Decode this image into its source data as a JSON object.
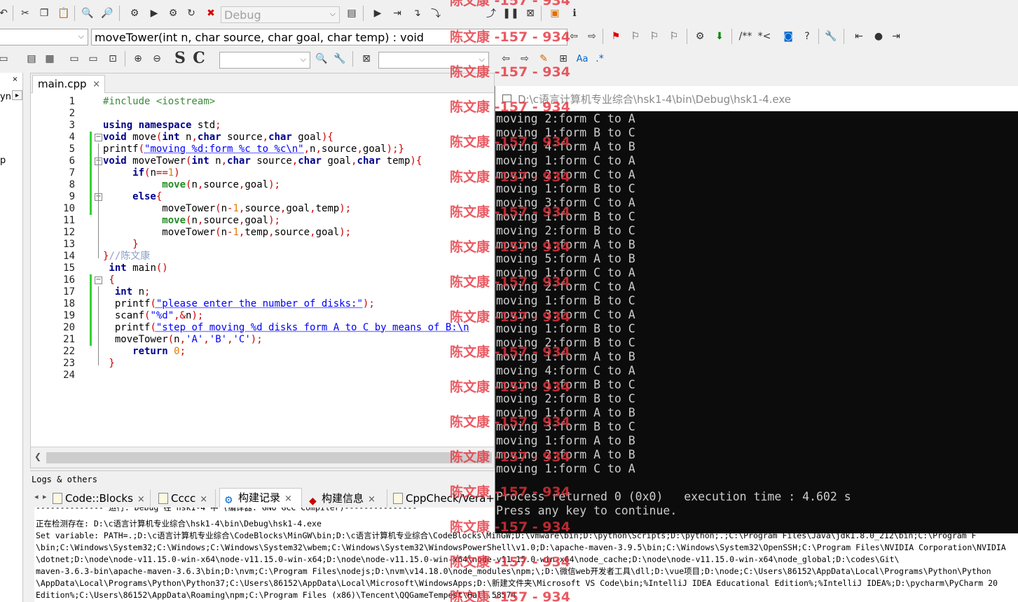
{
  "toolbar": {
    "build_target": "Debug",
    "function_signature": "moveTower(int n, char source, char goal, char temp) : void",
    "search_text": "",
    "find_text": "",
    "label_s": "S",
    "label_c": "C",
    "doc_comment": "/**",
    "comment_star": "*<",
    "regex_label": ".*"
  },
  "left_panel": {
    "close_label": "×",
    "arrow_label": "▸",
    "cut_text_1": "yn",
    "cut_text_2": "p"
  },
  "editor": {
    "tab_label": "main.cpp",
    "tab_close": "×",
    "line_numbers": [
      "1",
      "2",
      "3",
      "4",
      "5",
      "6",
      "7",
      "8",
      "9",
      "10",
      "11",
      "12",
      "13",
      "14",
      "15",
      "16",
      "17",
      "18",
      "19",
      "20",
      "21",
      "22",
      "23",
      "24"
    ],
    "lines": [
      [
        {
          "t": "#include <iostream>",
          "c": "#3c8a3c"
        }
      ],
      [],
      [
        {
          "t": "using namespace ",
          "c": "#00008b",
          "b": true
        },
        {
          "t": "std",
          "c": "#000"
        },
        {
          "t": ";",
          "c": "#cc0000"
        }
      ],
      [
        {
          "t": "void ",
          "c": "#00008b",
          "b": true
        },
        {
          "t": "move",
          "c": "#000"
        },
        {
          "t": "(",
          "c": "#cc0000"
        },
        {
          "t": "int ",
          "c": "#00008b",
          "b": true
        },
        {
          "t": "n",
          "c": "#000"
        },
        {
          "t": ",",
          "c": "#cc0000"
        },
        {
          "t": "char ",
          "c": "#00008b",
          "b": true
        },
        {
          "t": "source",
          "c": "#000"
        },
        {
          "t": ",",
          "c": "#cc0000"
        },
        {
          "t": "char ",
          "c": "#00008b",
          "b": true
        },
        {
          "t": "goal",
          "c": "#000"
        },
        {
          "t": "){",
          "c": "#cc0000"
        }
      ],
      [
        {
          "t": "printf",
          "c": "#000"
        },
        {
          "t": "(",
          "c": "#cc0000"
        },
        {
          "t": "\"moving %d:form %c to %c\\n\"",
          "c": "#0000ff",
          "u": true
        },
        {
          "t": ",",
          "c": "#cc0000"
        },
        {
          "t": "n",
          "c": "#000"
        },
        {
          "t": ",",
          "c": "#cc0000"
        },
        {
          "t": "source",
          "c": "#000"
        },
        {
          "t": ",",
          "c": "#cc0000"
        },
        {
          "t": "goal",
          "c": "#000"
        },
        {
          "t": ");}",
          "c": "#cc0000"
        }
      ],
      [
        {
          "t": "void ",
          "c": "#00008b",
          "b": true
        },
        {
          "t": "moveTower",
          "c": "#000"
        },
        {
          "t": "(",
          "c": "#cc0000"
        },
        {
          "t": "int ",
          "c": "#00008b",
          "b": true
        },
        {
          "t": "n",
          "c": "#000"
        },
        {
          "t": ",",
          "c": "#cc0000"
        },
        {
          "t": "char ",
          "c": "#00008b",
          "b": true
        },
        {
          "t": "source",
          "c": "#000"
        },
        {
          "t": ",",
          "c": "#cc0000"
        },
        {
          "t": "char ",
          "c": "#00008b",
          "b": true
        },
        {
          "t": "goal",
          "c": "#000"
        },
        {
          "t": ",",
          "c": "#cc0000"
        },
        {
          "t": "char ",
          "c": "#00008b",
          "b": true
        },
        {
          "t": "temp",
          "c": "#000"
        },
        {
          "t": "){",
          "c": "#cc0000"
        }
      ],
      [
        {
          "t": "     if",
          "c": "#00008b",
          "b": true
        },
        {
          "t": "(",
          "c": "#cc0000"
        },
        {
          "t": "n",
          "c": "#000"
        },
        {
          "t": "==",
          "c": "#cc0000"
        },
        {
          "t": "1",
          "c": "#e07a00"
        },
        {
          "t": ")",
          "c": "#cc0000"
        }
      ],
      [
        {
          "t": "          move",
          "c": "#228b22",
          "b": true
        },
        {
          "t": "(",
          "c": "#cc0000"
        },
        {
          "t": "n",
          "c": "#000"
        },
        {
          "t": ",",
          "c": "#cc0000"
        },
        {
          "t": "source",
          "c": "#000"
        },
        {
          "t": ",",
          "c": "#cc0000"
        },
        {
          "t": "goal",
          "c": "#000"
        },
        {
          "t": ");",
          "c": "#cc0000"
        }
      ],
      [
        {
          "t": "     else",
          "c": "#00008b",
          "b": true
        },
        {
          "t": "{",
          "c": "#cc0000"
        }
      ],
      [
        {
          "t": "          moveTower",
          "c": "#000"
        },
        {
          "t": "(",
          "c": "#cc0000"
        },
        {
          "t": "n",
          "c": "#000"
        },
        {
          "t": "-",
          "c": "#cc0000"
        },
        {
          "t": "1",
          "c": "#e07a00"
        },
        {
          "t": ",",
          "c": "#cc0000"
        },
        {
          "t": "source",
          "c": "#000"
        },
        {
          "t": ",",
          "c": "#cc0000"
        },
        {
          "t": "goal",
          "c": "#000"
        },
        {
          "t": ",",
          "c": "#cc0000"
        },
        {
          "t": "temp",
          "c": "#000"
        },
        {
          "t": ");",
          "c": "#cc0000"
        }
      ],
      [
        {
          "t": "          move",
          "c": "#228b22",
          "b": true
        },
        {
          "t": "(",
          "c": "#cc0000"
        },
        {
          "t": "n",
          "c": "#000"
        },
        {
          "t": ",",
          "c": "#cc0000"
        },
        {
          "t": "source",
          "c": "#000"
        },
        {
          "t": ",",
          "c": "#cc0000"
        },
        {
          "t": "goal",
          "c": "#000"
        },
        {
          "t": ");",
          "c": "#cc0000"
        }
      ],
      [
        {
          "t": "          moveTower",
          "c": "#000"
        },
        {
          "t": "(",
          "c": "#cc0000"
        },
        {
          "t": "n",
          "c": "#000"
        },
        {
          "t": "-",
          "c": "#cc0000"
        },
        {
          "t": "1",
          "c": "#e07a00"
        },
        {
          "t": ",",
          "c": "#cc0000"
        },
        {
          "t": "temp",
          "c": "#000"
        },
        {
          "t": ",",
          "c": "#cc0000"
        },
        {
          "t": "source",
          "c": "#000"
        },
        {
          "t": ",",
          "c": "#cc0000"
        },
        {
          "t": "goal",
          "c": "#000"
        },
        {
          "t": ");",
          "c": "#cc0000"
        }
      ],
      [
        {
          "t": "     }",
          "c": "#cc0000"
        }
      ],
      [
        {
          "t": "}",
          "c": "#cc0000"
        },
        {
          "t": "//陈文康",
          "c": "#8aa0c8"
        }
      ],
      [
        {
          "t": " int ",
          "c": "#00008b",
          "b": true
        },
        {
          "t": "main",
          "c": "#000"
        },
        {
          "t": "()",
          "c": "#cc0000"
        }
      ],
      [
        {
          "t": " {",
          "c": "#cc0000"
        }
      ],
      [
        {
          "t": "  int ",
          "c": "#00008b",
          "b": true
        },
        {
          "t": "n",
          "c": "#000"
        },
        {
          "t": ";",
          "c": "#cc0000"
        }
      ],
      [
        {
          "t": "  printf",
          "c": "#000"
        },
        {
          "t": "(",
          "c": "#cc0000"
        },
        {
          "t": "\"please enter the number of disks:\"",
          "c": "#0000ff",
          "u": true
        },
        {
          "t": ");",
          "c": "#cc0000"
        }
      ],
      [
        {
          "t": "  scanf",
          "c": "#000"
        },
        {
          "t": "(",
          "c": "#cc0000"
        },
        {
          "t": "\"%d\"",
          "c": "#0000ff"
        },
        {
          "t": ",&",
          "c": "#cc0000"
        },
        {
          "t": "n",
          "c": "#000"
        },
        {
          "t": ");",
          "c": "#cc0000"
        }
      ],
      [
        {
          "t": "  printf",
          "c": "#000"
        },
        {
          "t": "(",
          "c": "#cc0000"
        },
        {
          "t": "\"step of moving %d disks form A to C by means of B:\\n",
          "c": "#0000ff",
          "u": true
        }
      ],
      [
        {
          "t": "  moveTower",
          "c": "#000"
        },
        {
          "t": "(",
          "c": "#cc0000"
        },
        {
          "t": "n",
          "c": "#000"
        },
        {
          "t": ",",
          "c": "#cc0000"
        },
        {
          "t": "'A'",
          "c": "#0000ff"
        },
        {
          "t": ",",
          "c": "#cc0000"
        },
        {
          "t": "'B'",
          "c": "#0000ff"
        },
        {
          "t": ",",
          "c": "#cc0000"
        },
        {
          "t": "'C'",
          "c": "#0000ff"
        },
        {
          "t": ");",
          "c": "#cc0000"
        }
      ],
      [
        {
          "t": "     return ",
          "c": "#00008b",
          "b": true
        },
        {
          "t": "0",
          "c": "#e07a00"
        },
        {
          "t": ";",
          "c": "#cc0000"
        }
      ],
      [
        {
          "t": " }",
          "c": "#cc0000"
        }
      ],
      []
    ]
  },
  "logs": {
    "title": "Logs & others",
    "tabs": [
      {
        "label": "Code::Blocks",
        "close": "×"
      },
      {
        "label": "Cccc",
        "close": "×"
      },
      {
        "label": "构建记录",
        "close": "×"
      },
      {
        "label": "构建信息",
        "close": "×"
      },
      {
        "label": "CppCheck/Vera+",
        "close": ""
      }
    ],
    "lines": [
      "-------------- 运行: Debug 在 hsk1-4 中 (编译器: GNU GCC Compiler)---------------",
      "正在检测存在: D:\\c语言计算机专业综合\\hsk1-4\\bin\\Debug\\hsk1-4.exe",
      "Set variable: PATH=.;D:\\c语言计算机专业综合\\CodeBlocks\\MinGW\\bin;D:\\c语言计算机专业综合\\CodeBlocks\\MinGW;D:\\vmware\\bin;D:\\python\\Scripts;D:\\python;.;C:\\Program Files\\Java\\jdk1.8.0_212\\bin;C:\\Program F",
      "\\bin;C:\\Windows\\System32;C:\\Windows;C:\\Windows\\System32\\wbem;C:\\Windows\\System32\\WindowsPowerShell\\v1.0;D:\\apache-maven-3.9.5\\bin;C:\\Windows\\System32\\OpenSSH;C:\\Program Files\\NVIDIA Corporation\\NVIDIA",
      "\\dotnet;D:\\node\\node-v11.15.0-win-x64\\node-v11.15.0-win-x64;D:\\node\\node-v11.15.0-win-x64\\node-v11.15.0-win-x64\\node_cache;D:\\node\\node-v11.15.0-win-x64\\node_global;D:\\codes\\Git\\",
      "maven-3.6.3-bin\\apache-maven-3.6.3\\bin;D:\\nvm;C:\\Program Files\\nodejs;D:\\nvm\\v14.18.0\\node_modules\\npm;\\;D:\\微信web开发者工具\\dll;D:\\vue项目;D:\\node;C:\\Users\\86152\\AppData\\Local\\Programs\\Python\\Python",
      "\\AppData\\Local\\Programs\\Python\\Python37;C:\\Users\\86152\\AppData\\Local\\Microsoft\\WindowsApps;D:\\新建文件夹\\Microsoft VS Code\\bin;%IntelliJ IDEA Educational Edition%;%IntelliJ IDEA%;D:\\pycharm\\PyCharm 20",
      "Edition%;C:\\Users\\86152\\AppData\\Roaming\\npm;C:\\Program Files (x86)\\Tencent\\QQGameTempest\\Hall.58574"
    ]
  },
  "console": {
    "title": "D:\\c语言计算机专业综合\\hsk1-4\\bin\\Debug\\hsk1-4.exe",
    "lines": [
      "moving 2:form C to A",
      "moving 1:form B to C",
      "moving 4:form A to B",
      "moving 1:form C to A",
      "moving 2:form C to A",
      "moving 1:form B to C",
      "moving 3:form C to A",
      "moving 1:form B to C",
      "moving 2:form B to C",
      "moving 1:form A to B",
      "moving 5:form A to B",
      "moving 1:form C to A",
      "moving 2:form C to A",
      "moving 1:form B to C",
      "moving 3:form C to A",
      "moving 1:form B to C",
      "moving 2:form B to C",
      "moving 1:form A to B",
      "moving 4:form C to A",
      "moving 1:form B to C",
      "moving 2:form B to C",
      "moving 1:form A to B",
      "moving 3:form B to C",
      "moving 1:form A to B",
      "moving 2:form A to B",
      "moving 1:form C to A",
      "",
      "Process returned 0 (0x0)   execution time : 4.602 s",
      "Press any key to continue."
    ]
  },
  "watermark": {
    "text": "陈文康 -157 - 934",
    "color": "#e6323c"
  }
}
